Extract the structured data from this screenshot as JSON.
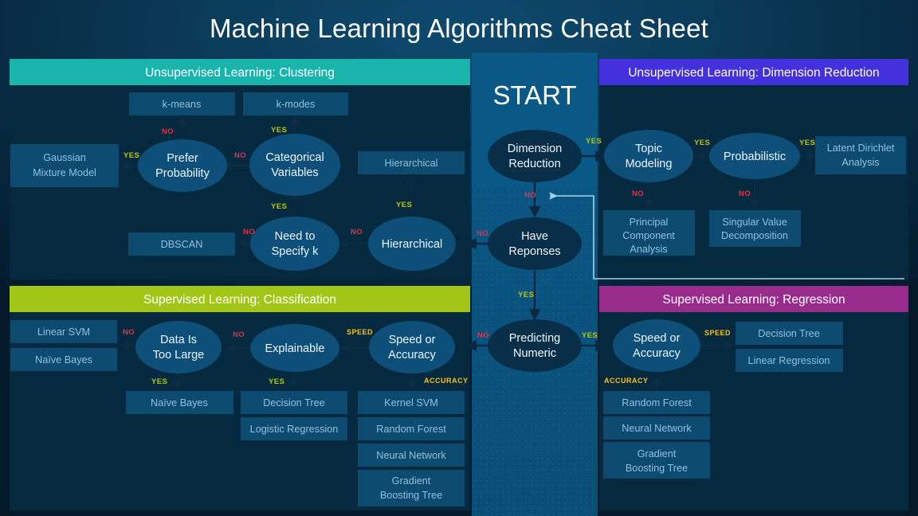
{
  "page": {
    "title": "Machine Learning Algorithms Cheat Sheet",
    "start_label": "START"
  },
  "colors": {
    "background": "#072238",
    "panel_background": "#05293f",
    "center_column": "#0a5381",
    "clustering_header": "#19b5ac",
    "dimension_reduction_header": "#4430dd",
    "classification_header": "#a2c617",
    "regression_header": "#992b8d",
    "ellipse_panel": "#0d4f78",
    "ellipse_center": "#092f48",
    "leaf_box": "#0d4a70",
    "leaf_text": "#8dc2dd",
    "label_yes": "#b7c60f",
    "label_no": "#e0354a",
    "label_gold": "#ffc20e",
    "feedback_line": "#9fd3ec"
  },
  "center": {
    "nodes": [
      {
        "id": "dimension-reduction",
        "label_line1": "Dimension",
        "label_line2": "Reduction"
      },
      {
        "id": "have-responses",
        "label_line1": "Have",
        "label_line2": "Reponses"
      },
      {
        "id": "predicting-numeric",
        "label_line1": "Predicting",
        "label_line2": "Numeric"
      }
    ],
    "edge_labels": {
      "dr_yes": "YES",
      "dr_no": "NO",
      "hr_no": "NO",
      "hr_yes": "YES",
      "pn_no": "NO",
      "pn_yes": "YES"
    }
  },
  "panels": {
    "clustering": {
      "header": "Unsupervised Learning: Clustering",
      "nodes": [
        {
          "id": "prefer-probability",
          "label_line1": "Prefer",
          "label_line2": "Probability"
        },
        {
          "id": "categorical-variables",
          "label_line1": "Categorical",
          "label_line2": "Variables"
        },
        {
          "id": "need-to-specify-k",
          "label_line1": "Need to",
          "label_line2": "Specify k"
        },
        {
          "id": "hierarchical-decision",
          "label_line1": "Hierarchical",
          "label_line2": ""
        }
      ],
      "boxes": [
        {
          "id": "k-means",
          "label": "k-means"
        },
        {
          "id": "k-modes",
          "label": "k-modes"
        },
        {
          "id": "gaussian-mixture-model",
          "label_line1": "Gaussian",
          "label_line2": "Mixture Model"
        },
        {
          "id": "hierarchical-result",
          "label": "Hierarchical"
        },
        {
          "id": "dbscan",
          "label": "DBSCAN"
        }
      ],
      "edge_labels": {
        "pp_to_kmeans": "NO",
        "pp_to_gmm": "YES",
        "cv_to_kmodes": "YES",
        "cv_to_pp": "NO",
        "k_to_cv": "YES",
        "k_to_dbscan": "NO",
        "hier_to_box": "YES",
        "hier_to_k": "NO"
      }
    },
    "dimension_reduction": {
      "header": "Unsupervised Learning: Dimension Reduction",
      "nodes": [
        {
          "id": "topic-modeling",
          "label_line1": "Topic",
          "label_line2": "Modeling"
        },
        {
          "id": "probabilistic",
          "label_line1": "Probabilistic",
          "label_line2": ""
        }
      ],
      "boxes": [
        {
          "id": "latent-dirichlet-analysis",
          "label_line1": "Latent Dirichlet",
          "label_line2": "Analysis"
        },
        {
          "id": "principal-component-analysis",
          "label_line1": "Principal",
          "label_line2": "Component",
          "label_line3": "Analysis"
        },
        {
          "id": "singular-value-decomposition",
          "label_line1": "Singular Value",
          "label_line2": "Decomposition"
        }
      ],
      "edge_labels": {
        "tm_to_prob": "YES",
        "tm_to_pca": "NO",
        "prob_to_lda": "YES",
        "prob_to_svd": "NO"
      }
    },
    "classification": {
      "header": "Supervised Learning: Classification",
      "nodes": [
        {
          "id": "data-is-too-large",
          "label_line1": "Data Is",
          "label_line2": "Too Large"
        },
        {
          "id": "explainable",
          "label_line1": "Explainable",
          "label_line2": ""
        },
        {
          "id": "speed-or-accuracy-classification",
          "label_line1": "Speed or",
          "label_line2": "Accuracy"
        }
      ],
      "boxes": [
        {
          "id": "linear-svm",
          "label": "Linear SVM"
        },
        {
          "id": "naive-bayes-left",
          "label": "Naïve Bayes"
        },
        {
          "id": "naive-bayes-below",
          "label": "Naïve Bayes"
        },
        {
          "id": "decision-tree-classification",
          "label": "Decision Tree"
        },
        {
          "id": "logistic-regression",
          "label": "Logistic Regression"
        },
        {
          "id": "kernel-svm",
          "label": "Kernel SVM"
        },
        {
          "id": "random-forest-classification",
          "label": "Random Forest"
        },
        {
          "id": "neural-network-classification",
          "label": "Neural Network"
        },
        {
          "id": "gradient-boosting-tree-classification",
          "label_line1": "Gradient",
          "label_line2": "Boosting Tree"
        }
      ],
      "edge_labels": {
        "dl_to_svm": "NO",
        "dl_to_nb": "YES",
        "exp_to_dl": "NO",
        "exp_to_dt": "YES",
        "sa_to_exp": "SPEED",
        "sa_to_kernel": "ACCURACY"
      }
    },
    "regression": {
      "header": "Supervised Learning: Regression",
      "nodes": [
        {
          "id": "speed-or-accuracy-regression",
          "label_line1": "Speed or",
          "label_line2": "Accuracy"
        }
      ],
      "boxes": [
        {
          "id": "decision-tree-regression",
          "label": "Decision Tree"
        },
        {
          "id": "linear-regression",
          "label": "Linear Regression"
        },
        {
          "id": "random-forest-regression",
          "label": "Random Forest"
        },
        {
          "id": "neural-network-regression",
          "label": "Neural Network"
        },
        {
          "id": "gradient-boosting-tree-regression",
          "label_line1": "Gradient",
          "label_line2": "Boosting Tree"
        }
      ],
      "edge_labels": {
        "sa_speed": "SPEED",
        "sa_accuracy": "ACCURACY"
      }
    }
  }
}
